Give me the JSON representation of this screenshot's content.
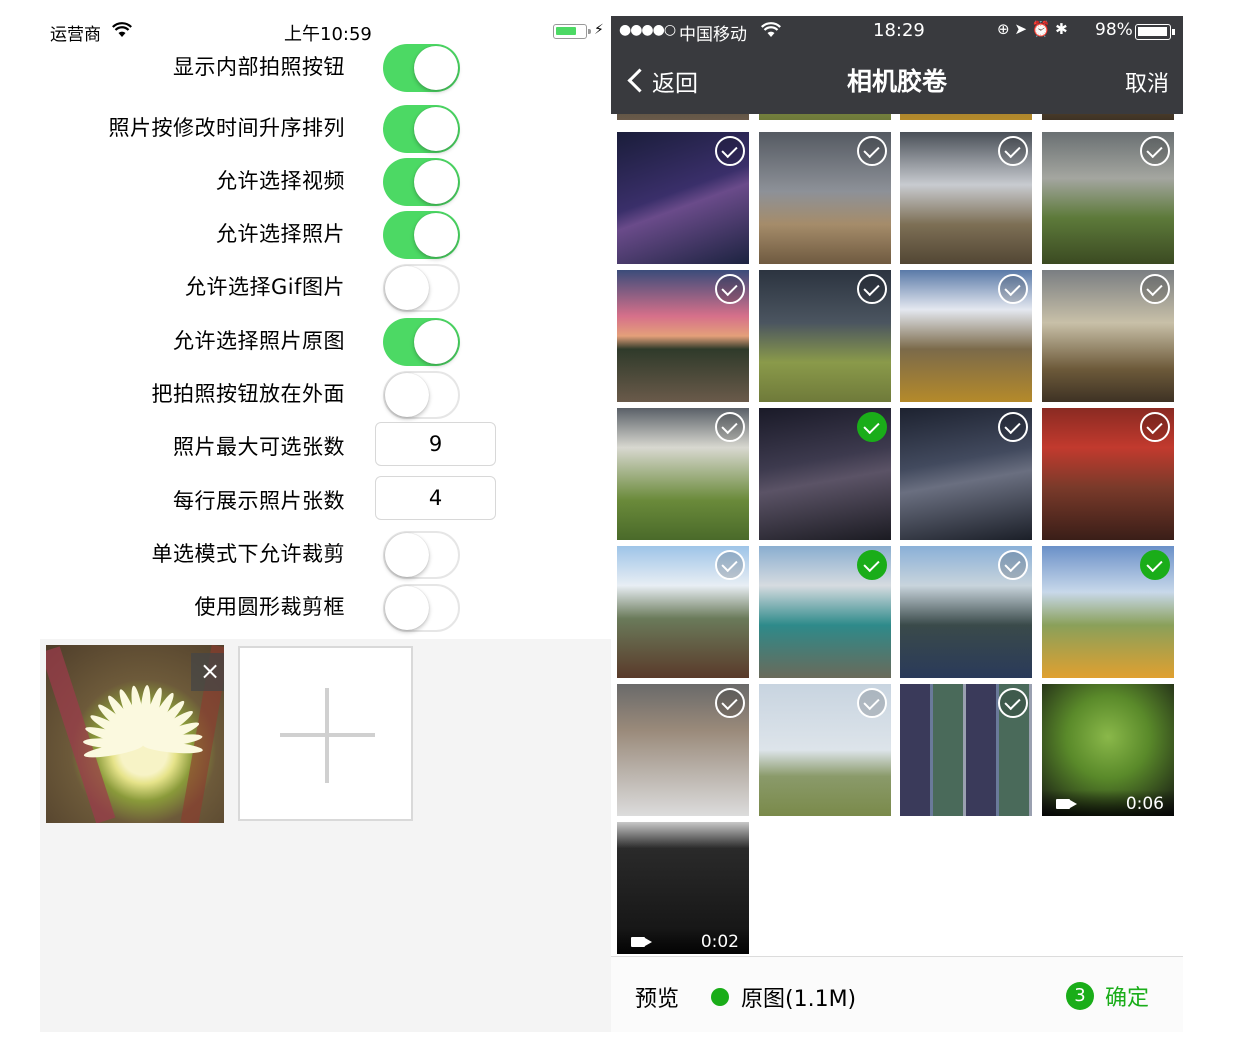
{
  "left": {
    "status": {
      "carrier": "运营商",
      "time": "上午10:59"
    },
    "settings": [
      {
        "label": "显示内部拍照按钮",
        "type": "switch",
        "on": true
      },
      {
        "label": "照片按修改时间升序排列",
        "type": "switch",
        "on": true
      },
      {
        "label": "允许选择视频",
        "type": "switch",
        "on": true
      },
      {
        "label": "允许选择照片",
        "type": "switch",
        "on": true
      },
      {
        "label": "允许选择Gif图片",
        "type": "switch",
        "on": false
      },
      {
        "label": "允许选择照片原图",
        "type": "switch",
        "on": true
      },
      {
        "label": "把拍照按钮放在外面",
        "type": "switch",
        "on": false
      },
      {
        "label": "照片最大可选张数",
        "type": "number",
        "value": "9"
      },
      {
        "label": "每行展示照片张数",
        "type": "number",
        "value": "4"
      },
      {
        "label": "单选模式下允许裁剪",
        "type": "switch",
        "on": false
      },
      {
        "label": "使用圆形裁剪框",
        "type": "switch",
        "on": false
      }
    ],
    "close_glyph": "×"
  },
  "right": {
    "status": {
      "carrier": "中国移动",
      "time": "18:29",
      "battery": "98%"
    },
    "nav": {
      "back": "返回",
      "title": "相机胶卷",
      "cancel": "取消"
    },
    "photos": [
      {
        "selected": false
      },
      {
        "selected": false
      },
      {
        "selected": false
      },
      {
        "selected": false
      },
      {
        "selected": false
      },
      {
        "selected": false
      },
      {
        "selected": false
      },
      {
        "selected": false
      },
      {
        "selected": false
      },
      {
        "selected": true
      },
      {
        "selected": false
      },
      {
        "selected": false
      },
      {
        "selected": false
      },
      {
        "selected": true
      },
      {
        "selected": false
      },
      {
        "selected": true
      },
      {
        "selected": false
      },
      {
        "selected": false
      },
      {
        "selected": false
      },
      {
        "video": "0:06"
      },
      {
        "video": "0:02"
      }
    ],
    "toolbar": {
      "preview": "预览",
      "original": "原图(1.1M)",
      "count": "3",
      "confirm": "确定"
    },
    "colors": {
      "accent": "#1aad19",
      "nav": "#393a3e",
      "switch_on": "#4cd964"
    }
  }
}
